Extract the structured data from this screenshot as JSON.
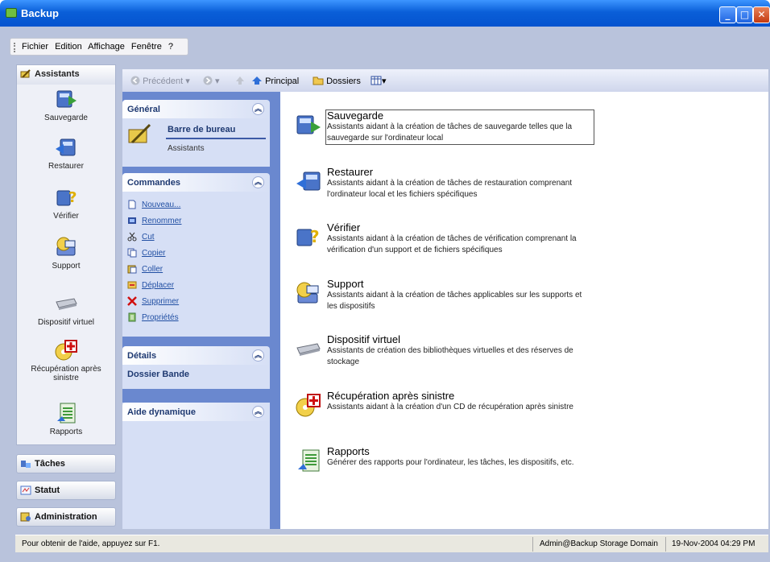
{
  "window": {
    "title": "Backup",
    "min_label": "_",
    "max_label": "□",
    "close_label": "✕"
  },
  "menu": [
    "Fichier",
    "Edition",
    "Affichage",
    "Fenêtre",
    "?"
  ],
  "left_panel": {
    "header": "Assistants",
    "items": [
      "Sauvegarde",
      "Restaurer",
      "Vérifier",
      "Support",
      "Dispositif virtuel",
      "Récupération après sinistre",
      "Rapports"
    ]
  },
  "nav": [
    "Tâches",
    "Statut",
    "Administration"
  ],
  "toolbar": {
    "back": "Précédent",
    "home": "Principal",
    "folders": "Dossiers"
  },
  "taskpane": {
    "general": {
      "title": "Général",
      "link": "Barre de bureau",
      "sub": "Assistants"
    },
    "commands": {
      "title": "Commandes",
      "items": [
        "Nouveau...",
        "Renommer",
        "Cut",
        "Copier",
        "Coller",
        "Déplacer",
        "Supprimer",
        "Propriétés"
      ]
    },
    "details": {
      "title": "Détails",
      "value": "Dossier Bande"
    },
    "help": {
      "title": "Aide dynamique"
    }
  },
  "entries": [
    {
      "title": "Sauvegarde",
      "desc": "Assistants aidant à la création de tâches de sauvegarde telles que la sauvegarde sur l'ordinateur local"
    },
    {
      "title": "Restaurer",
      "desc": "Assistants aidant à la création de tâches de restauration comprenant l'ordinateur local et les fichiers spécifiques"
    },
    {
      "title": "Vérifier",
      "desc": "Assistants aidant à la création de tâches de vérification comprenant la vérification d'un support et de fichiers spécifiques"
    },
    {
      "title": "Support",
      "desc": "Assistants aidant à la création de tâches applicables sur les supports et les dispositifs"
    },
    {
      "title": "Dispositif virtuel",
      "desc": "Assistants de création des bibliothèques virtuelles et des réserves de stockage"
    },
    {
      "title": "Récupération après sinistre",
      "desc": "Assistants aidant à la création d'un CD de récupération après sinistre"
    },
    {
      "title": "Rapports",
      "desc": "Générer des rapports pour l'ordinateur, les tâches, les dispositifs, etc."
    }
  ],
  "status": {
    "help": "Pour obtenir de l'aide, appuyez sur F1.",
    "user": "Admin@Backup Storage Domain",
    "datetime": "19-Nov-2004 04:29 PM"
  }
}
